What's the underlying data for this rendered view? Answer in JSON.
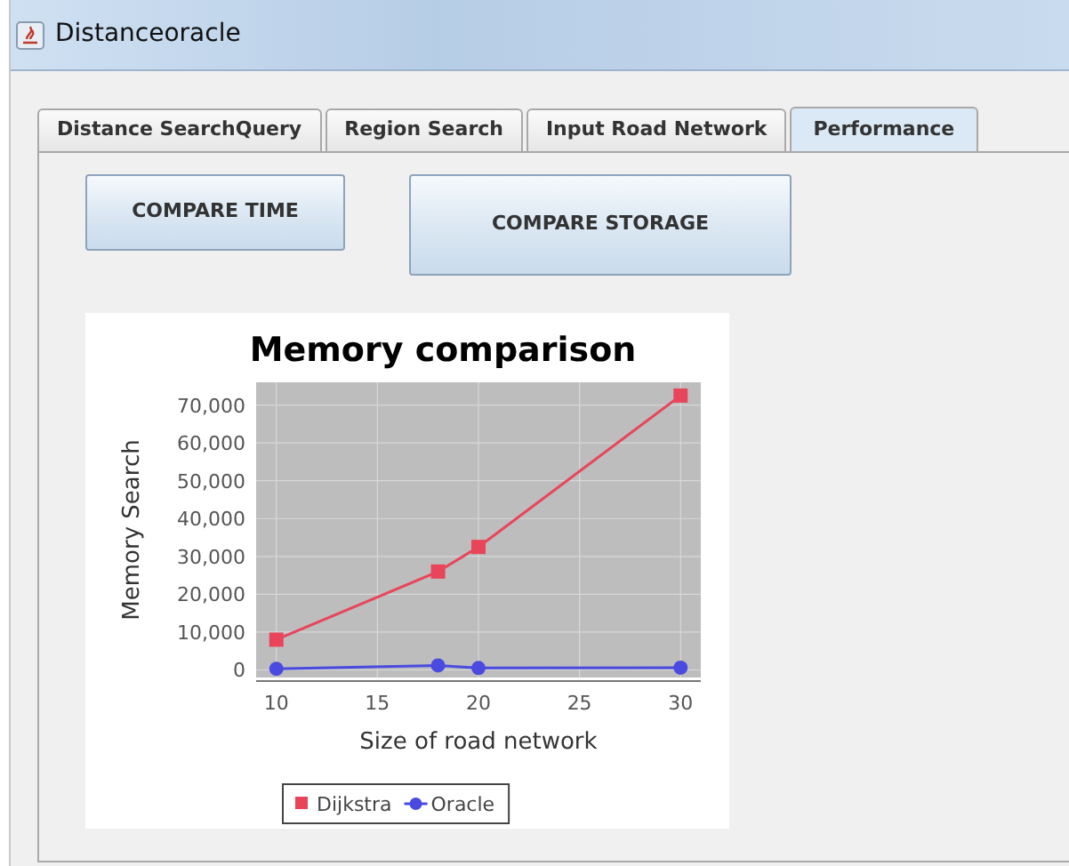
{
  "window": {
    "title": "Distanceoracle"
  },
  "tabs": [
    {
      "label": "Distance SearchQuery",
      "selected": false
    },
    {
      "label": "Region Search",
      "selected": false
    },
    {
      "label": "Input Road Network",
      "selected": false
    },
    {
      "label": "Performance",
      "selected": true
    }
  ],
  "buttons": [
    "COMPARE TIME",
    "COMPARE STORAGE"
  ],
  "chart": {
    "chart_data": {
      "type": "line",
      "title": "Memory comparison",
      "xlabel": "Size of road network",
      "ylabel": "Memory Search",
      "x": [
        10,
        18,
        20,
        30
      ],
      "grid": true,
      "legend": "bottom",
      "series": [
        {
          "name": "Dijkstra",
          "color": "#e8455a",
          "marker": "square",
          "values": [
            8000,
            26000,
            32500,
            72500
          ]
        },
        {
          "name": "Oracle",
          "color": "#4a4ae0",
          "marker": "circle",
          "values": [
            300,
            1200,
            500,
            600
          ]
        }
      ],
      "xlim": [
        9,
        31
      ],
      "ylim": [
        -2000,
        76000
      ],
      "xticks": [
        10,
        15,
        20,
        25,
        30
      ],
      "yticks": [
        {
          "value": 0,
          "label": "0"
        },
        {
          "value": 10000,
          "label": "10,000"
        },
        {
          "value": 20000,
          "label": "20,000"
        },
        {
          "value": 30000,
          "label": "30,000"
        },
        {
          "value": 40000,
          "label": "40,000"
        },
        {
          "value": 50000,
          "label": "50,000"
        },
        {
          "value": 60000,
          "label": "60,000"
        },
        {
          "value": 70000,
          "label": "70,000"
        }
      ]
    }
  }
}
